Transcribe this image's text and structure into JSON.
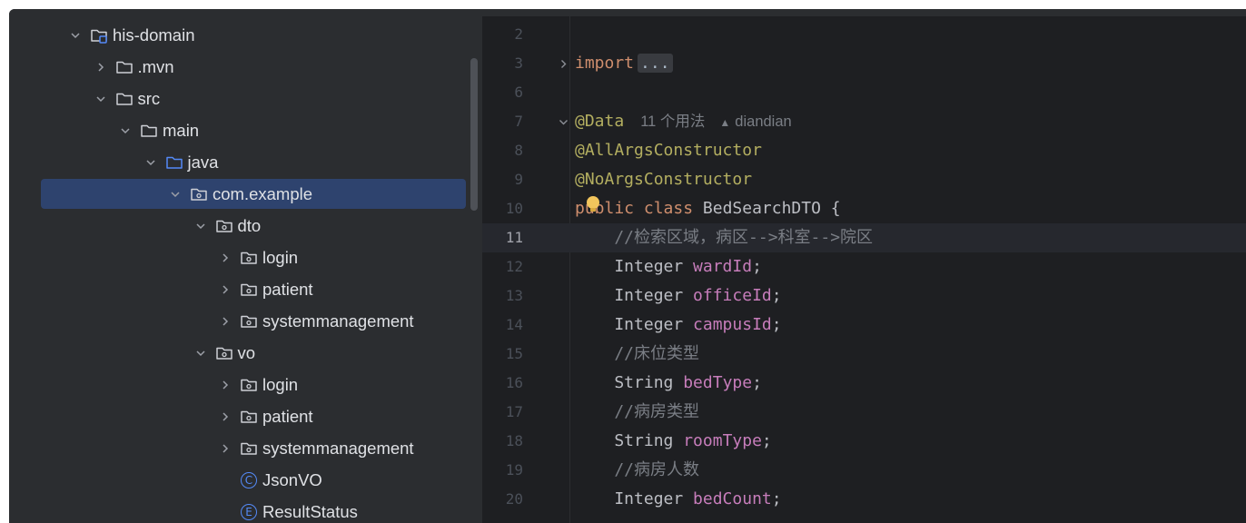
{
  "project_tree": {
    "items": [
      {
        "label": "his-domain",
        "indent": 0,
        "expanded": true,
        "icon": "module-folder-icon"
      },
      {
        "label": ".mvn",
        "indent": 1,
        "expanded": false,
        "icon": "folder-icon"
      },
      {
        "label": "src",
        "indent": 1,
        "expanded": true,
        "icon": "folder-icon"
      },
      {
        "label": "main",
        "indent": 2,
        "expanded": true,
        "icon": "folder-icon"
      },
      {
        "label": "java",
        "indent": 3,
        "expanded": true,
        "icon": "source-folder-icon"
      },
      {
        "label": "com.example",
        "indent": 4,
        "expanded": true,
        "icon": "package-icon",
        "selected": true
      },
      {
        "label": "dto",
        "indent": 5,
        "expanded": true,
        "icon": "package-icon"
      },
      {
        "label": "login",
        "indent": 6,
        "expanded": false,
        "icon": "package-icon"
      },
      {
        "label": "patient",
        "indent": 6,
        "expanded": false,
        "icon": "package-icon"
      },
      {
        "label": "systemmanagement",
        "indent": 6,
        "expanded": false,
        "icon": "package-icon"
      },
      {
        "label": "vo",
        "indent": 5,
        "expanded": true,
        "icon": "package-icon"
      },
      {
        "label": "login",
        "indent": 6,
        "expanded": false,
        "icon": "package-icon"
      },
      {
        "label": "patient",
        "indent": 6,
        "expanded": false,
        "icon": "package-icon"
      },
      {
        "label": "systemmanagement",
        "indent": 6,
        "expanded": false,
        "icon": "package-icon"
      },
      {
        "label": "JsonVO",
        "indent": 6,
        "icon": "class-icon",
        "badge": "C"
      },
      {
        "label": "ResultStatus",
        "indent": 6,
        "icon": "enum-icon",
        "badge": "E"
      }
    ]
  },
  "editor": {
    "current_line": "11",
    "lines": [
      {
        "num": "2",
        "tokens": []
      },
      {
        "num": "3",
        "fold": "collapsed",
        "tokens": [
          {
            "t": "import",
            "c": "kw"
          },
          {
            "t": "...",
            "c": "folded"
          }
        ]
      },
      {
        "num": "6",
        "tokens": []
      },
      {
        "num": "7",
        "fold": "expanded",
        "tokens": [
          {
            "t": "@Data",
            "c": "ann"
          }
        ],
        "inlay": {
          "usages": "11 个用法",
          "author": "diandian"
        }
      },
      {
        "num": "8",
        "tokens": [
          {
            "t": "@AllArgsConstructor",
            "c": "ann"
          }
        ]
      },
      {
        "num": "9",
        "tokens": [
          {
            "t": "@NoArgsConstructor",
            "c": "ann"
          }
        ]
      },
      {
        "num": "10",
        "tokens": [
          {
            "t": "public class ",
            "c": "kw"
          },
          {
            "t": "BedSearchDTO {",
            "c": "plain"
          }
        ]
      },
      {
        "num": "11",
        "tokens": [
          {
            "t": "    //检索区域，病区-->科室-->院区",
            "c": "cmt"
          }
        ]
      },
      {
        "num": "12",
        "tokens": [
          {
            "t": "    Integer ",
            "c": "plain"
          },
          {
            "t": "wardId",
            "c": "fld"
          },
          {
            "t": ";",
            "c": "plain"
          }
        ]
      },
      {
        "num": "13",
        "tokens": [
          {
            "t": "    Integer ",
            "c": "plain"
          },
          {
            "t": "officeId",
            "c": "fld"
          },
          {
            "t": ";",
            "c": "plain"
          }
        ]
      },
      {
        "num": "14",
        "tokens": [
          {
            "t": "    Integer ",
            "c": "plain"
          },
          {
            "t": "campusId",
            "c": "fld"
          },
          {
            "t": ";",
            "c": "plain"
          }
        ]
      },
      {
        "num": "15",
        "tokens": [
          {
            "t": "    //床位类型",
            "c": "cmt"
          }
        ]
      },
      {
        "num": "16",
        "tokens": [
          {
            "t": "    String ",
            "c": "plain"
          },
          {
            "t": "bedType",
            "c": "fld"
          },
          {
            "t": ";",
            "c": "plain"
          }
        ]
      },
      {
        "num": "17",
        "tokens": [
          {
            "t": "    //病房类型",
            "c": "cmt"
          }
        ]
      },
      {
        "num": "18",
        "tokens": [
          {
            "t": "    String ",
            "c": "plain"
          },
          {
            "t": "roomType",
            "c": "fld"
          },
          {
            "t": ";",
            "c": "plain"
          }
        ]
      },
      {
        "num": "19",
        "tokens": [
          {
            "t": "    //病房人数",
            "c": "cmt"
          }
        ]
      },
      {
        "num": "20",
        "tokens": [
          {
            "t": "    Integer ",
            "c": "plain"
          },
          {
            "t": "bedCount",
            "c": "fld"
          },
          {
            "t": ";",
            "c": "plain"
          }
        ]
      }
    ]
  },
  "colors": {
    "tree_bg": "#2b2d30",
    "editor_bg": "#1e1f22",
    "selection": "#2e436e",
    "keyword": "#cf8e6d",
    "annotation": "#b3ae60",
    "field": "#c77dbb",
    "comment": "#7a7e85"
  }
}
